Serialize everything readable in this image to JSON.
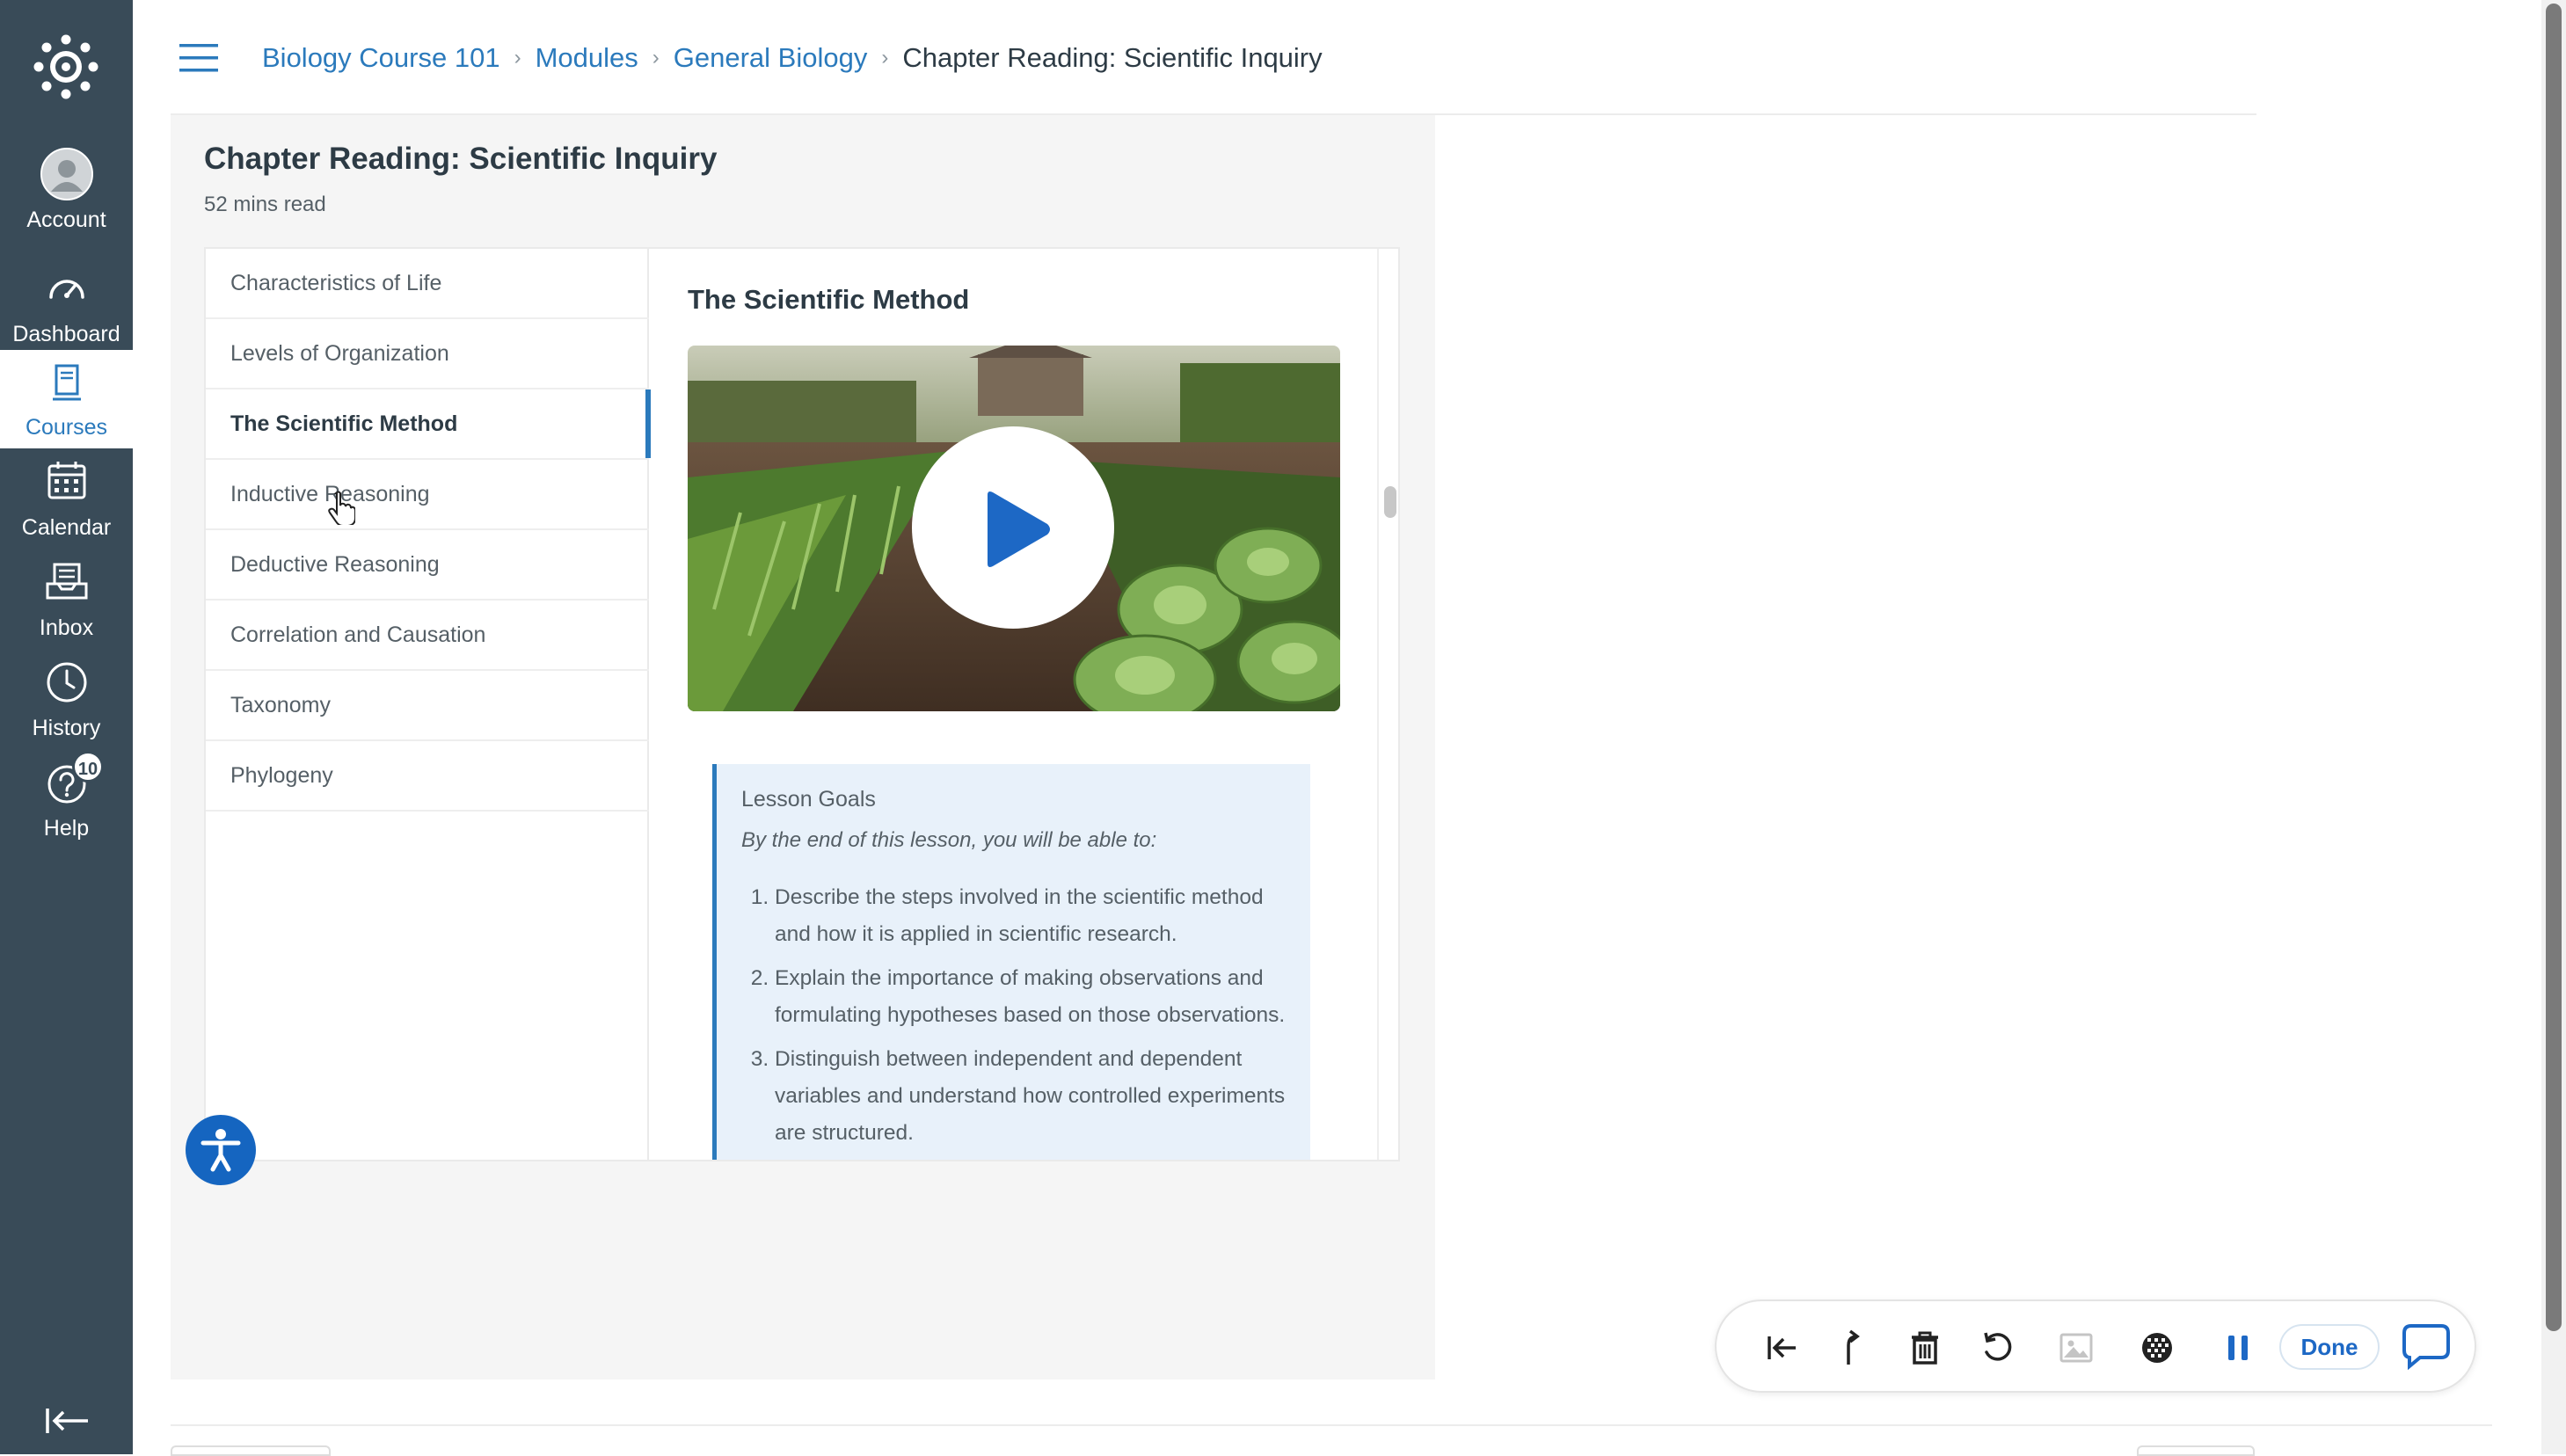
{
  "global_nav": {
    "items": [
      {
        "label": "Account",
        "icon": "account-avatar-icon"
      },
      {
        "label": "Dashboard",
        "icon": "dashboard-gauge-icon"
      },
      {
        "label": "Courses",
        "icon": "courses-book-icon",
        "active": true
      },
      {
        "label": "Calendar",
        "icon": "calendar-icon"
      },
      {
        "label": "Inbox",
        "icon": "inbox-icon"
      },
      {
        "label": "History",
        "icon": "clock-icon"
      },
      {
        "label": "Help",
        "icon": "help-icon",
        "badge": "10"
      }
    ]
  },
  "breadcrumb": {
    "items": [
      "Biology Course 101",
      "Modules",
      "General Biology"
    ],
    "current": "Chapter Reading: Scientific Inquiry"
  },
  "page": {
    "title": "Chapter Reading: Scientific Inquiry",
    "read_time": "52 mins read"
  },
  "toc": {
    "items": [
      "Characteristics of Life",
      "Levels of Organization",
      "The Scientific Method",
      "Inductive Reasoning",
      "Deductive Reasoning",
      "Correlation and Causation",
      "Taxonomy",
      "Phylogeny"
    ],
    "active_index": 2
  },
  "reader": {
    "section_title": "The Scientific Method",
    "goals": {
      "heading": "Lesson Goals",
      "subtitle": "By the end of this lesson, you will be able to:",
      "items": [
        "Describe the steps involved in the scientific method and how it is applied in scientific research.",
        "Explain the importance of making observations and formulating hypotheses based on those observations.",
        "Distinguish between independent and dependent variables and understand how controlled experiments are structured."
      ]
    }
  },
  "toolbar": {
    "done_label": "Done",
    "tools": [
      "rewind-to-start-icon",
      "share-arrow-icon",
      "trash-icon",
      "undo-icon",
      "image-icon",
      "blur-icon",
      "pause-icon",
      "chat-bubble-icon"
    ]
  },
  "colors": {
    "nav_bg": "#394b58",
    "accent": "#2b7abc",
    "panel_bg": "#f5f5f5",
    "goals_bg": "#e8f1fa",
    "a11y_button": "#1565c0"
  }
}
